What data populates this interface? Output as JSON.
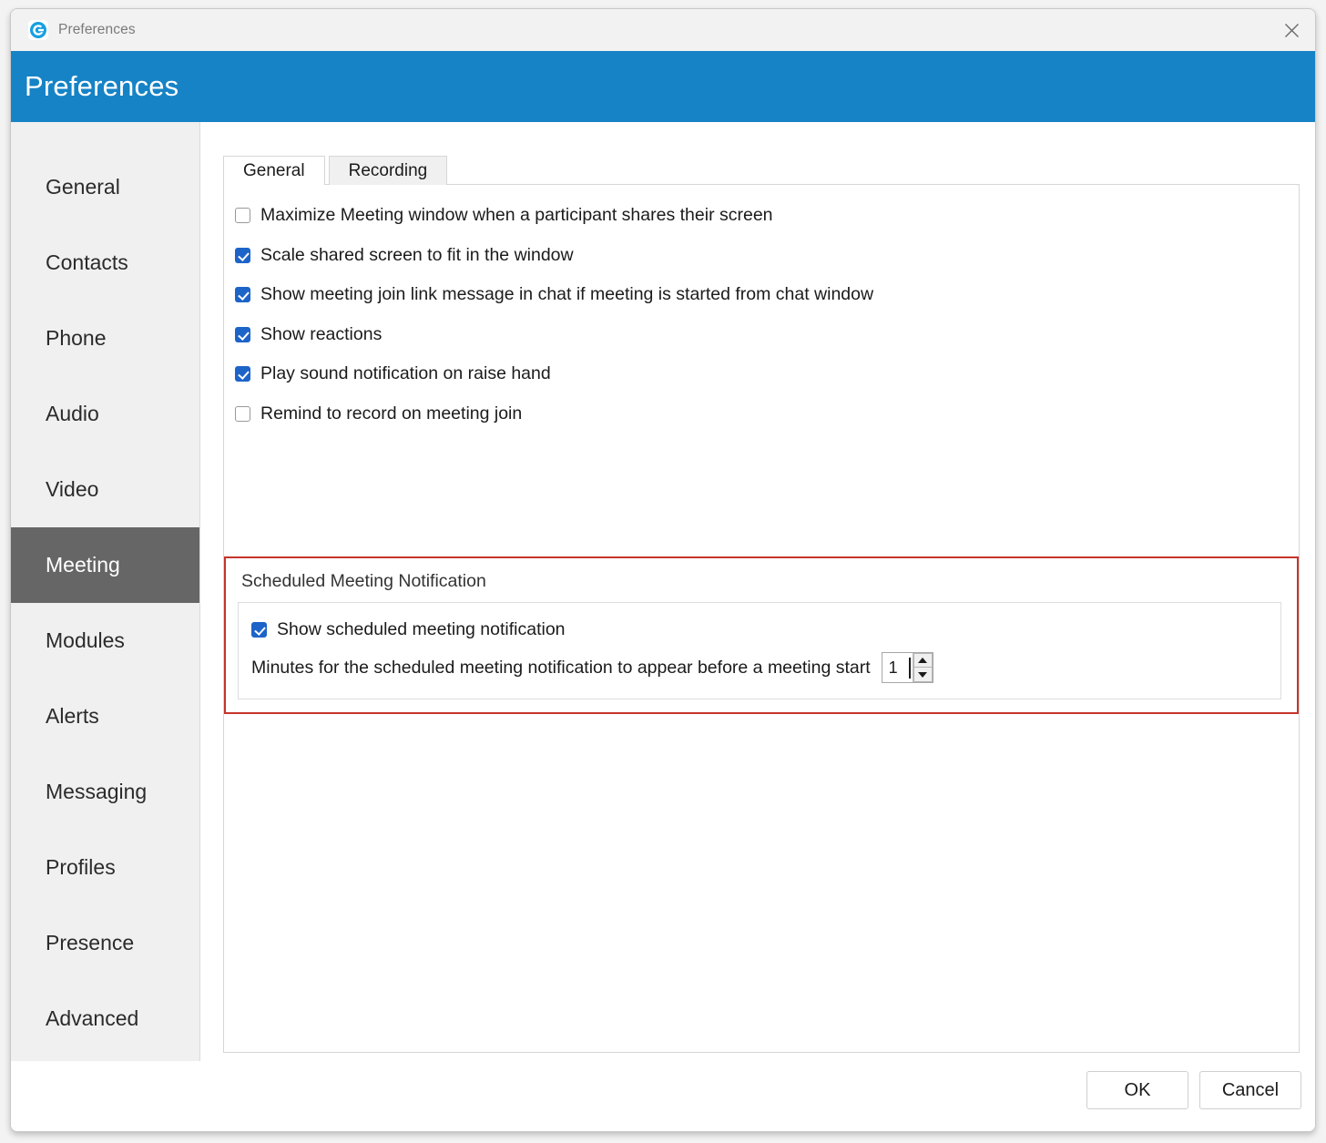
{
  "titlebar": {
    "title": "Preferences",
    "app_icon": "goto-g-logo-icon",
    "close_icon": "close-icon"
  },
  "banner": {
    "title": "Preferences",
    "color": "#1683c6"
  },
  "sidebar": {
    "items": [
      {
        "label": "General",
        "selected": false
      },
      {
        "label": "Contacts",
        "selected": false
      },
      {
        "label": "Phone",
        "selected": false
      },
      {
        "label": "Audio",
        "selected": false
      },
      {
        "label": "Video",
        "selected": false
      },
      {
        "label": "Meeting",
        "selected": true
      },
      {
        "label": "Modules",
        "selected": false
      },
      {
        "label": "Alerts",
        "selected": false
      },
      {
        "label": "Messaging",
        "selected": false
      },
      {
        "label": "Profiles",
        "selected": false
      },
      {
        "label": "Presence",
        "selected": false
      },
      {
        "label": "Advanced",
        "selected": false
      }
    ],
    "selected_color": "#666666"
  },
  "tabs": [
    {
      "label": "General",
      "active": true
    },
    {
      "label": "Recording",
      "active": false
    }
  ],
  "options": [
    {
      "label": "Maximize Meeting window when a participant shares their screen",
      "checked": false
    },
    {
      "label": "Scale shared screen to fit in the window",
      "checked": true
    },
    {
      "label": "Show meeting join link message in chat if meeting is started from chat window",
      "checked": true
    },
    {
      "label": "Show reactions",
      "checked": true
    },
    {
      "label": "Play sound notification on raise hand",
      "checked": true
    },
    {
      "label": "Remind to record on meeting join",
      "checked": false
    }
  ],
  "scheduled_group": {
    "legend": "Scheduled Meeting Notification",
    "highlight_color": "#c5342b",
    "show_notification": {
      "label": "Show scheduled meeting notification",
      "checked": true
    },
    "minutes": {
      "label": "Minutes for the scheduled meeting notification to appear before a meeting start",
      "value": "1",
      "increment_icon": "chevron-up-icon",
      "decrement_icon": "chevron-down-icon"
    }
  },
  "footer": {
    "ok_label": "OK",
    "cancel_label": "Cancel"
  },
  "checkbox_accent": "#1d64c8"
}
